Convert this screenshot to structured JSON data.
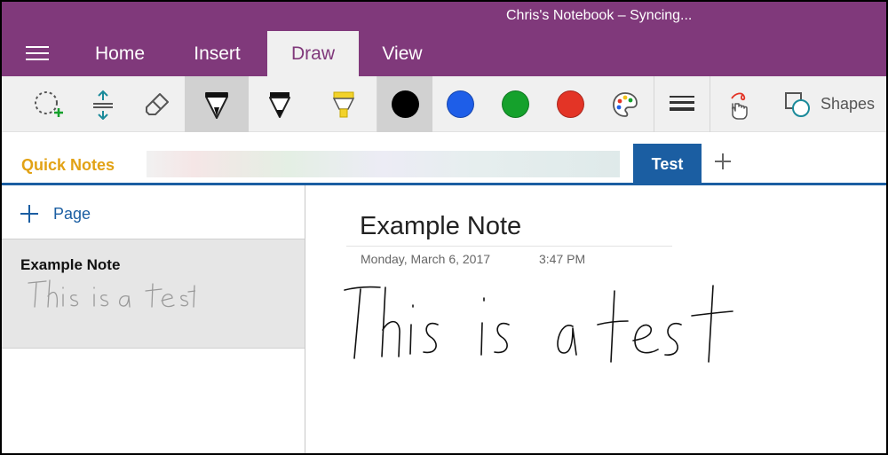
{
  "window": {
    "title": "Chris's Notebook – Syncing..."
  },
  "ribbon": {
    "tabs": [
      {
        "label": "Home",
        "active": false
      },
      {
        "label": "Insert",
        "active": false
      },
      {
        "label": "Draw",
        "active": true
      },
      {
        "label": "View",
        "active": false
      }
    ]
  },
  "toolbar": {
    "tools": [
      {
        "name": "lasso-select-icon"
      },
      {
        "name": "insert-space-icon"
      },
      {
        "name": "eraser-icon"
      },
      {
        "name": "pen-icon",
        "selected": true
      },
      {
        "name": "pencil-icon"
      },
      {
        "name": "highlighter-icon"
      }
    ],
    "colors": [
      {
        "name": "black",
        "hex": "#000000",
        "selected": true
      },
      {
        "name": "blue",
        "hex": "#1e5ee8"
      },
      {
        "name": "green",
        "hex": "#15a12c"
      },
      {
        "name": "red",
        "hex": "#e33426"
      },
      {
        "name": "more-colors",
        "icon": "palette-icon"
      }
    ],
    "shapes_label": "Shapes"
  },
  "sections": {
    "notebook_section": "Quick Notes",
    "active_tab": "Test",
    "accent_color": "#1b5ea2",
    "quick_notes_color": "#e2a215"
  },
  "pages": {
    "add_label": "Page",
    "items": [
      {
        "title": "Example Note",
        "preview": "This is a test"
      }
    ]
  },
  "note": {
    "title": "Example Note",
    "date": "Monday, March 6, 2017",
    "time": "3:47 PM",
    "ink_text": "This is a test"
  },
  "theme": {
    "brand": "#80397b"
  }
}
